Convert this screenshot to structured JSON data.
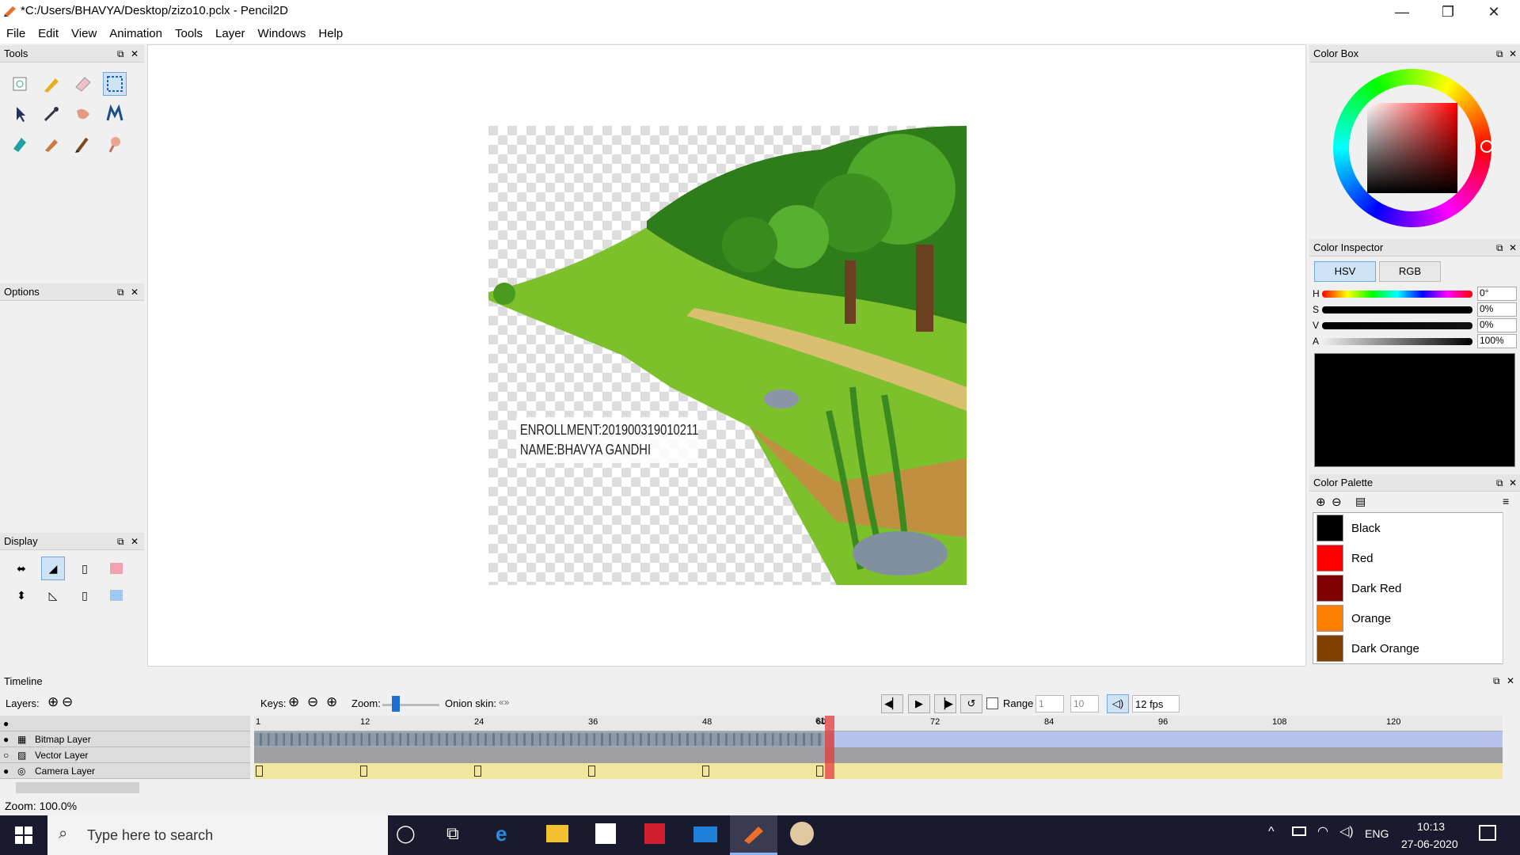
{
  "window": {
    "title": "*C:/Users/BHAVYA/Desktop/zizo10.pclx - Pencil2D",
    "min": "—",
    "max": "❐",
    "close": "✕"
  },
  "menu": [
    "File",
    "Edit",
    "View",
    "Animation",
    "Tools",
    "Layer",
    "Windows",
    "Help"
  ],
  "panels": {
    "tools": "Tools",
    "options": "Options",
    "display": "Display",
    "color_box": "Color Box",
    "color_inspector": "Color Inspector",
    "color_palette": "Color Palette",
    "timeline": "Timeline"
  },
  "canvas": {
    "line1": "ENROLLMENT:201900319010211",
    "line2": "NAME:BHAVYA GANDHI"
  },
  "inspector": {
    "tab_hsv": "HSV",
    "tab_rgb": "RGB",
    "rows": [
      {
        "label": "H",
        "value": "0°"
      },
      {
        "label": "S",
        "value": "0%"
      },
      {
        "label": "V",
        "value": "0%"
      },
      {
        "label": "A",
        "value": "100%"
      }
    ],
    "preview_color": "#000000"
  },
  "palette": [
    {
      "name": "Black",
      "color": "#000000"
    },
    {
      "name": "Red",
      "color": "#ff0000"
    },
    {
      "name": "Dark Red",
      "color": "#800000"
    },
    {
      "name": "Orange",
      "color": "#ff8000"
    },
    {
      "name": "Dark Orange",
      "color": "#804000"
    }
  ],
  "timeline": {
    "layers_label": "Layers:",
    "keys_label": "Keys:",
    "zoom_label": "Zoom:",
    "onion_label": "Onion skin:",
    "range_label": "Range",
    "range_start": "1",
    "range_end": "10",
    "fps": "12 fps",
    "current_frame": "61",
    "ticks": [
      "1",
      "12",
      "24",
      "36",
      "48",
      "60",
      "72",
      "84",
      "96",
      "108",
      "120"
    ],
    "layers": [
      "Bitmap Layer",
      "Vector Layer",
      "Camera Layer"
    ]
  },
  "status": {
    "zoom": "Zoom: 100.0%"
  },
  "taskbar": {
    "search_placeholder": "Type here to search",
    "lang": "ENG",
    "time": "10:13",
    "date": "27-06-2020"
  }
}
